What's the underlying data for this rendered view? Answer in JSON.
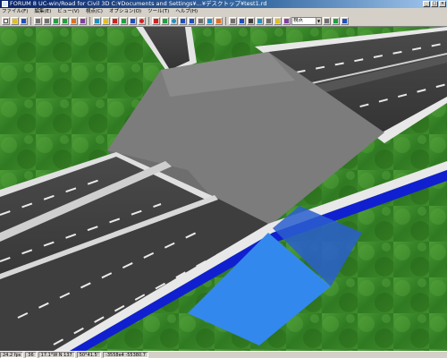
{
  "window": {
    "title": "FORUM 8   UC-win/Road for Civil 3D    C:¥Documents and Settings¥...¥デスクトップ¥test1.rd",
    "buttons": [
      "_",
      "□",
      "×"
    ]
  },
  "menu": [
    "ファイル(F)",
    "編集(E)",
    "ビュー(V)",
    "視点(C)",
    "オプション(O)",
    "ツール(T)",
    "ヘルプ(H)"
  ],
  "toolbar": {
    "view_select": "視点",
    "colors": {
      "red": "#d02020",
      "blue": "#2050c0",
      "green": "#20a040",
      "yellow": "#e0c020",
      "gray": "#707070",
      "cyan": "#2090c0",
      "purple": "#8040a0",
      "orange": "#e07020"
    }
  },
  "status": {
    "fps": "24.2 fps",
    "cell2": "36",
    "cell3": "17.1°W  N 137",
    "cell4": "50°41.5'",
    "cell5": "-3558e4  -55380.7"
  },
  "scene": {
    "colors": {
      "grass": "#3f8a2a",
      "asphalt": "#5a5a5a",
      "plaza": "#7c7c7c",
      "curb": "#e4e4e4",
      "water": "#3388ee",
      "edge_blue": "#1020d0"
    }
  }
}
